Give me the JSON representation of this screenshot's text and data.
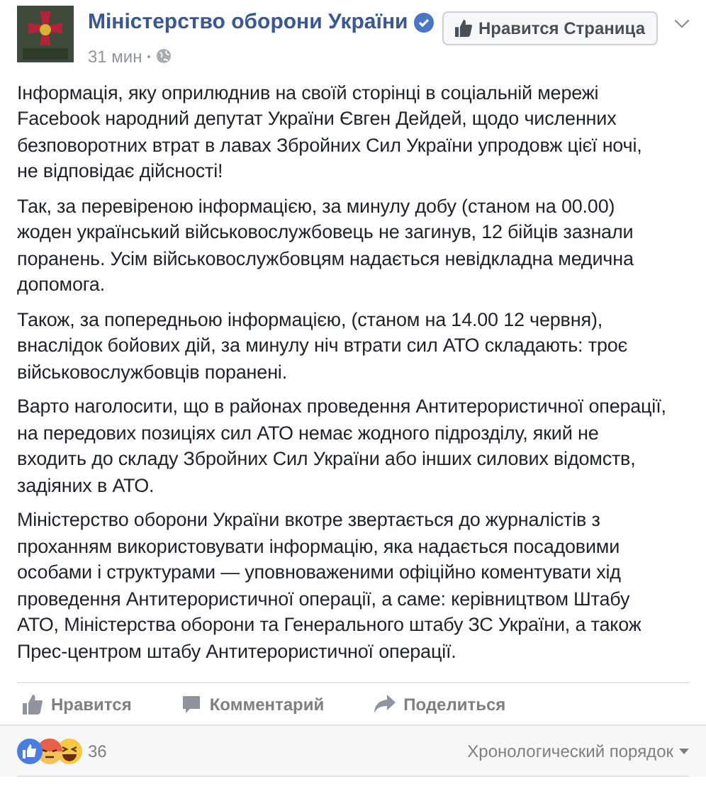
{
  "post": {
    "author": "Міністерство оборони України",
    "verified": true,
    "time": "31 мин",
    "like_page_button": "Нравится Страница",
    "paragraphs": [
      "Інформація, яку оприлюднив на своїй сторінці в соціальній мережі Facebook народний депутат України Євген Дейдей, щодо численних безповоротних втрат в лавах Збройних Сил України упродовж цієї ночі, не відповідає дійсності!",
      "Так, за перевіреною інформацією, за минулу добу (станом на 00.00) жоден український військовослужбовець не загинув, 12 бійців зазнали поранень. Усім військовослужбовцям надається невідкладна медична допомога.",
      "Також, за попередньою інформацією, (станом на 14.00 12 червня), внаслідок бойових дій, за минулу ніч втрати сил АТО складають: троє військовослужбовців поранені.",
      "Варто наголосити, що в районах проведення Антитерористичної операції, на передових позиціях сил АТО немає жодного підрозділу, який не входить до складу Збройних Сил України або інших силових відомств, задіяних в АТО.",
      "Міністерство оборони України вкотре звертається до журналістів з проханням використовувати інформацію, яка надається посадовими особами і структурами — уповноваженими офіційно коментувати хід проведення Антитерористичної операції, а саме: керівництвом Штабу АТО, Міністерства оборони та Генерального штабу ЗС України, а також Прес-центром штабу Антитерористичної операції."
    ],
    "actions": [
      {
        "kind": "like",
        "label": "Нравится"
      },
      {
        "kind": "comment",
        "label": "Комментарий"
      },
      {
        "kind": "share",
        "label": "Поделиться"
      }
    ],
    "reactions": {
      "items": [
        {
          "kind": "like"
        },
        {
          "kind": "angry"
        },
        {
          "kind": "haha"
        }
      ],
      "count": "36"
    },
    "sort": "Хронологический порядок"
  }
}
